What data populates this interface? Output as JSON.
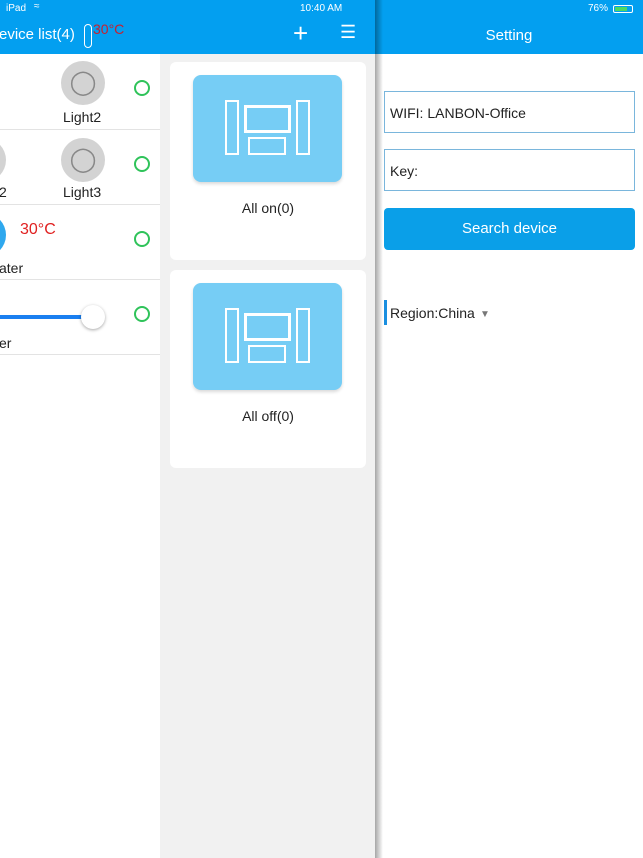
{
  "status": {
    "device": "iPad",
    "time": "10:40 AM",
    "battery": "76%"
  },
  "left_header": {
    "title": "evice list(4)",
    "temperature": "30°C"
  },
  "devices": [
    {
      "label": "Light2"
    },
    {
      "label_partial": "2",
      "label": "Light3"
    },
    {
      "temperature": "30°C",
      "label": "ater"
    },
    {
      "label": "er",
      "slider_value": 1.0
    }
  ],
  "scenes": [
    {
      "label": "All on(0)"
    },
    {
      "label": "All off(0)"
    }
  ],
  "setting": {
    "title": "Setting",
    "wifi_label": "WIFI:",
    "wifi_value": "LANBON-Office",
    "key_label": "Key:",
    "search_button": "Search device",
    "region": "Region:China"
  },
  "colors": {
    "accent": "#039ff0",
    "scene_icon": "#76cdf5",
    "online": "#2fc35a",
    "temperature": "#e02020"
  }
}
